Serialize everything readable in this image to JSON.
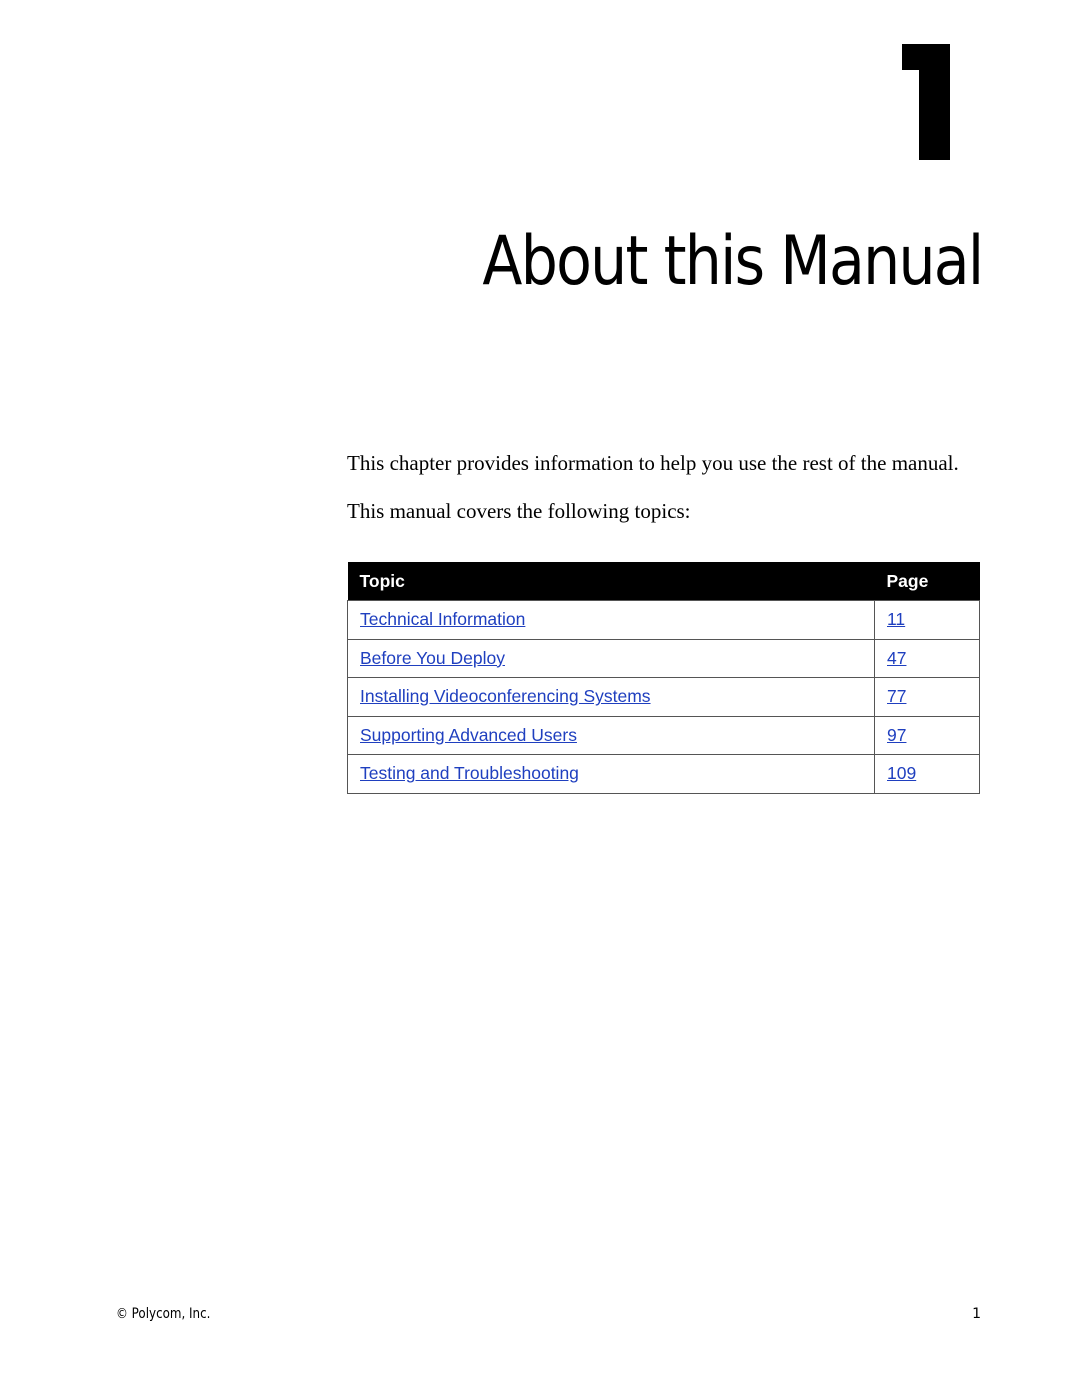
{
  "chapter": {
    "number": "1",
    "title": "About this Manual"
  },
  "intro": {
    "paragraph1": "This chapter provides information to help you use the rest of the manual.",
    "paragraph2": "This manual covers the following topics:"
  },
  "topics_table": {
    "headers": {
      "topic": "Topic",
      "page": "Page"
    },
    "rows": [
      {
        "topic": "Technical Information",
        "page": "11"
      },
      {
        "topic": "Before You Deploy",
        "page": "47"
      },
      {
        "topic": "Installing Videoconferencing Systems",
        "page": "77"
      },
      {
        "topic": "Supporting Advanced Users",
        "page": "97"
      },
      {
        "topic": "Testing and Troubleshooting",
        "page": "109"
      }
    ],
    "link_color": "#1f3fbf"
  },
  "footer": {
    "copyright": "© Polycom, Inc.",
    "page_number": "1"
  }
}
